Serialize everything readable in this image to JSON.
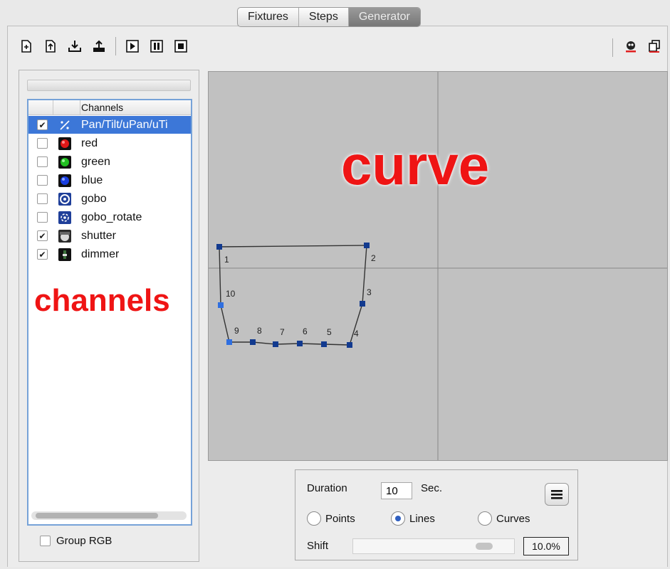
{
  "tabs": [
    {
      "label": "Fixtures",
      "active": false
    },
    {
      "label": "Steps",
      "active": false
    },
    {
      "label": "Generator",
      "active": true
    }
  ],
  "toolbar": {
    "left_icons": [
      "new-document-icon",
      "open-document-icon",
      "import-icon",
      "export-icon"
    ],
    "playback_icons": [
      "play-icon",
      "pause-icon",
      "stop-icon"
    ],
    "right_icons": [
      "fixture-icon",
      "copy-icon"
    ]
  },
  "channels": {
    "header": "Channels",
    "items": [
      {
        "label": "Pan/Tilt/uPan/uTi",
        "checked": true,
        "selected": true,
        "icon": "pan-tilt-icon"
      },
      {
        "label": "red",
        "checked": false,
        "selected": false,
        "icon": "red-color-icon",
        "color": "#e01818"
      },
      {
        "label": "green",
        "checked": false,
        "selected": false,
        "icon": "green-color-icon",
        "color": "#22c022"
      },
      {
        "label": "blue",
        "checked": false,
        "selected": false,
        "icon": "blue-color-icon",
        "color": "#1a3fe0"
      },
      {
        "label": "gobo",
        "checked": false,
        "selected": false,
        "icon": "gobo-icon"
      },
      {
        "label": "gobo_rotate",
        "checked": false,
        "selected": false,
        "icon": "gobo-rotate-icon"
      },
      {
        "label": "shutter",
        "checked": true,
        "selected": false,
        "icon": "shutter-icon"
      },
      {
        "label": "dimmer",
        "checked": true,
        "selected": false,
        "icon": "dimmer-icon"
      }
    ],
    "group_rgb_label": "Group RGB",
    "group_rgb_checked": false
  },
  "annotations": {
    "channels": "channels",
    "curve": "curve"
  },
  "curve_points": [
    {
      "label": "1"
    },
    {
      "label": "2"
    },
    {
      "label": "3"
    },
    {
      "label": "4"
    },
    {
      "label": "5"
    },
    {
      "label": "6"
    },
    {
      "label": "7"
    },
    {
      "label": "8"
    },
    {
      "label": "9"
    },
    {
      "label": "10"
    }
  ],
  "generator": {
    "duration_label": "Duration",
    "duration_value": "10",
    "duration_unit": "Sec.",
    "modes": [
      {
        "label": "Points",
        "selected": false
      },
      {
        "label": "Lines",
        "selected": true
      },
      {
        "label": "Curves",
        "selected": false
      }
    ],
    "shift_label": "Shift",
    "shift_value": "10.0%",
    "shift_level": 0.1
  },
  "colors": {
    "selection": "#3c77d8",
    "annotation": "#ef1414",
    "canvas": "#c1c1c1",
    "point": "#123a8f"
  }
}
